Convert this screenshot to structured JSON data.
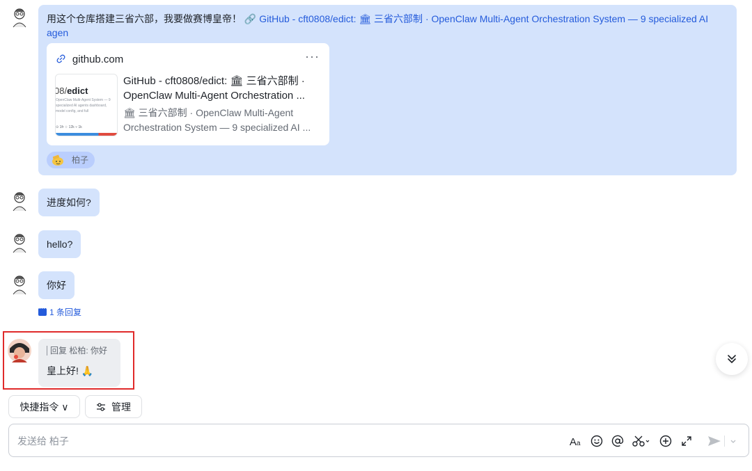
{
  "messages": {
    "m1": {
      "text": "用这个仓库搭建三省六部，我要做赛博皇帝！",
      "link_text": " 🔗 GitHub - cft0808/edict: 🏛 三省六部制 · OpenClaw Multi-Agent Orchestration System — 9 specialized AI agen",
      "card": {
        "domain": "github.com",
        "more": "···",
        "title": "GitHub - cft0808/edict: 🏛 三省六部制 · OpenClaw Multi-Agent Orchestration ...",
        "description": "🏛 三省六部制 · OpenClaw Multi-Agent Orchestration System — 9 specialized AI ...",
        "thumb": {
          "repo_prefix": "08/",
          "repo_name": "edict",
          "desc": "OpenClaw Multi-Agent System — 9 specialized AI agents dashboard, model config, and full",
          "stats": "⊙ 1fr   ☆ 12k   ⑂ 1k"
        }
      },
      "reaction": {
        "name": "柏子",
        "emoji": "salute-face"
      }
    },
    "m2": {
      "text": "进度如何?"
    },
    "m3": {
      "text": "hello?"
    },
    "m4": {
      "text": "你好",
      "reply_count": "1 条回复"
    },
    "m5": {
      "quote": "回复 松柏: 你好",
      "text": "皇上好! 🙏"
    }
  },
  "quick": {
    "commands": "快捷指令 ∨",
    "manage": "管理"
  },
  "composer": {
    "placeholder": "发送给 柏子",
    "tools": [
      "text-format-icon",
      "emoji-icon",
      "mention-icon",
      "screenshot-icon",
      "add-icon",
      "expand-icon",
      "send-icon"
    ]
  },
  "colors": {
    "bubble": "#d4e3fc",
    "link": "#245bdb",
    "highlight": "#e02a2a",
    "quote_bubble": "#eceef1"
  }
}
